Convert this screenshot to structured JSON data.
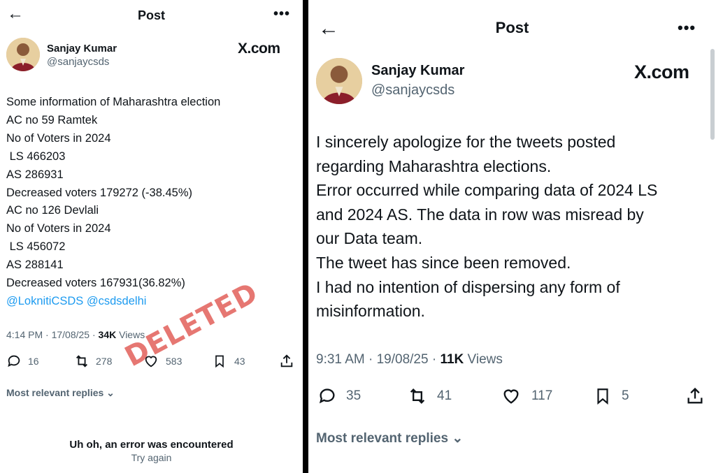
{
  "left": {
    "header": {
      "back_icon": "arrow-left-icon",
      "title": "Post",
      "more_icon": "more-dots-icon"
    },
    "author": {
      "name": "Sanjay Kumar",
      "handle": "@sanjaycsds",
      "source": "X.com"
    },
    "lines": [
      "Some information of Maharashtra election",
      "AC no 59 Ramtek",
      "No of Voters in 2024",
      " LS 466203",
      "AS 286931",
      "Decreased voters 179272 (-38.45%)",
      "AC no 126 Devlali",
      "No of Voters in 2024",
      " LS 456072",
      "AS 288141",
      "Decreased voters 167931(36.82%)"
    ],
    "mentions": "@LoknitiCSDS @csdsdelhi",
    "meta": {
      "time": "4:14 PM · 17/08/25 · ",
      "views_count": "34K",
      "views_label": " Views"
    },
    "actions": {
      "replies": "16",
      "reposts": "278",
      "likes": "583",
      "bookmarks": "43"
    },
    "replies_sort": "Most relevant replies",
    "stamp": "DELETED",
    "error": {
      "title": "Uh oh, an error was encountered",
      "retry": "Try again"
    }
  },
  "right": {
    "header": {
      "back_icon": "arrow-left-icon",
      "title": "Post",
      "more_icon": "more-dots-icon"
    },
    "author": {
      "name": "Sanjay Kumar",
      "handle": "@sanjaycsds",
      "source": "X.com"
    },
    "lines": [
      "I sincerely apologize for the tweets posted",
      "regarding Maharashtra elections.",
      "Error occurred while comparing data of 2024 LS",
      "and 2024 AS. The data in row was misread by",
      "our Data team.",
      "The tweet has since been removed.",
      "I had no intention of dispersing any form of",
      "misinformation."
    ],
    "meta": {
      "time": "9:31 AM · 19/08/25 · ",
      "views_count": "11K",
      "views_label": " Views"
    },
    "actions": {
      "replies": "35",
      "reposts": "41",
      "likes": "117",
      "bookmarks": "5"
    },
    "replies_sort": "Most relevant replies"
  },
  "colors": {
    "text": "#0f1419",
    "muted": "#536471",
    "link": "#1d9bf0",
    "stamp": "#e0564f",
    "divider": "#000000"
  }
}
